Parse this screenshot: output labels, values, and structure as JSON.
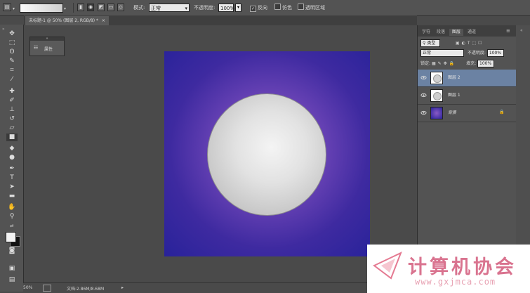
{
  "options_bar": {
    "mode_label": "模式:",
    "mode_value": "正常",
    "opacity_label": "不透明度:",
    "opacity_value": "100%",
    "reverse_label": "反向",
    "dither_label": "仿色",
    "transparency_label": "透明区域"
  },
  "document": {
    "tab_title": "未标题-1 @ 50% (图层 2, RGB/8) *",
    "close_glyph": "×"
  },
  "mini_panel": {
    "header_glyph": "»",
    "label": "属性"
  },
  "status_bar": {
    "zoom": "50%",
    "doc_info": "文档:2.86M/8.68M"
  },
  "layers_panel": {
    "tabs": [
      "字符",
      "段落",
      "图层",
      "通道"
    ],
    "active_tab_index": 2,
    "filter_value": "类型",
    "blend_mode": "正常",
    "opacity_label": "不透明度:",
    "opacity_value": "100%",
    "lock_label": "锁定:",
    "fill_label": "填充:",
    "fill_value": "100%",
    "layers": [
      {
        "name": "图层 2",
        "selected": true
      },
      {
        "name": "图层 1",
        "selected": false
      },
      {
        "name": "背景",
        "selected": false,
        "locked": true
      }
    ]
  },
  "watermark": {
    "site_name": "计算机协会",
    "url": "www.gxjmca.com"
  },
  "colors": {
    "canvas_center": "#8a5ac4",
    "canvas_edge": "#28229a",
    "circle_center": "#f4f4f4",
    "circle_edge": "#aaaaaa",
    "selected_layer": "#6b82a3",
    "watermark_text": "#d9738f"
  }
}
